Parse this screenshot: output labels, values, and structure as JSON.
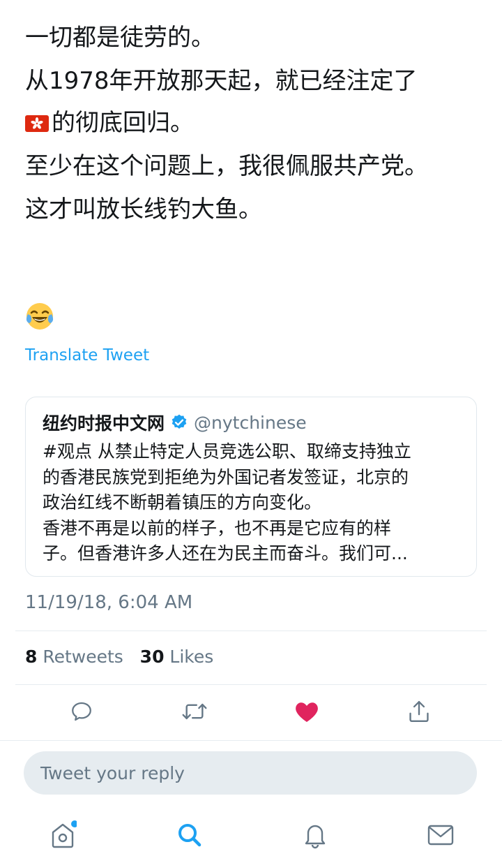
{
  "tweet": {
    "paragraphs": {
      "p1": "一切都是徒劳的。",
      "p2_a": "从1978年开放那天起，就已经注定了",
      "p2_b": "的彻底回归。",
      "p3": "至少在这个问题上，我很佩服共产党。",
      "p4": "这才叫放长线钓大鱼。"
    },
    "translate_label": "Translate Tweet",
    "timestamp": "11/19/18, 6:04 AM",
    "retweet_count": "8",
    "retweet_label": "Retweets",
    "like_count": "30",
    "like_label": "Likes"
  },
  "quoted_tweet": {
    "display_name": "纽约时报中文网",
    "handle": "@nytchinese",
    "text_lines": {
      "l1": "#观点 从禁止特定人员竞选公职、取缔支持独立",
      "l2": "的香港民族党到拒绝为外国记者发签证，北京的",
      "l3": "政治红线不断朝着镇压的方向变化。",
      "l4": "香港不再是以前的样子，也不再是它应有的样",
      "l5": "子。但香港许多人还在为民主而奋斗。我们可..."
    }
  },
  "reply": {
    "placeholder": "Tweet your reply"
  },
  "icons": {
    "flag": "hong-kong-flag-emoji",
    "emoji": "face-with-tears-of-joy-emoji",
    "verified": "verified-badge-icon",
    "reply": "reply-icon",
    "retweet": "retweet-icon",
    "like": "heart-icon",
    "share": "share-icon",
    "home": "home-icon",
    "search": "search-icon",
    "notifications": "bell-icon",
    "messages": "mail-icon"
  },
  "colors": {
    "accent": "#1da1f2",
    "like_active": "#e0245e",
    "text_primary": "#14171a",
    "text_secondary": "#657786",
    "hk_flag_red": "#de2910"
  }
}
